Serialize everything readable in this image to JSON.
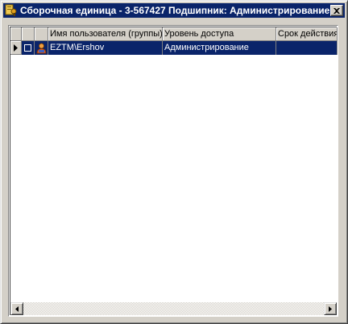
{
  "window": {
    "title": "Сборочная единица - 3-567427 Подшипник: Администрирование",
    "app_icon": "key-icon",
    "close_icon": "close-icon"
  },
  "grid": {
    "columns": [
      {
        "key": "indicator",
        "label": ""
      },
      {
        "key": "check",
        "label": ""
      },
      {
        "key": "icon",
        "label": ""
      },
      {
        "key": "user",
        "label": "Имя пользователя (группы)"
      },
      {
        "key": "level",
        "label": "Уровень доступа"
      },
      {
        "key": "term",
        "label": "Срок действия"
      }
    ],
    "rows": [
      {
        "user": "EZTM\\Ershov",
        "level": "Администрирование",
        "term": "",
        "selected": true,
        "checked": false,
        "icon": "user-icon"
      }
    ]
  },
  "colors": {
    "titlebar": "#0a246a",
    "selection": "#0a246a",
    "face": "#d4d0c8"
  }
}
